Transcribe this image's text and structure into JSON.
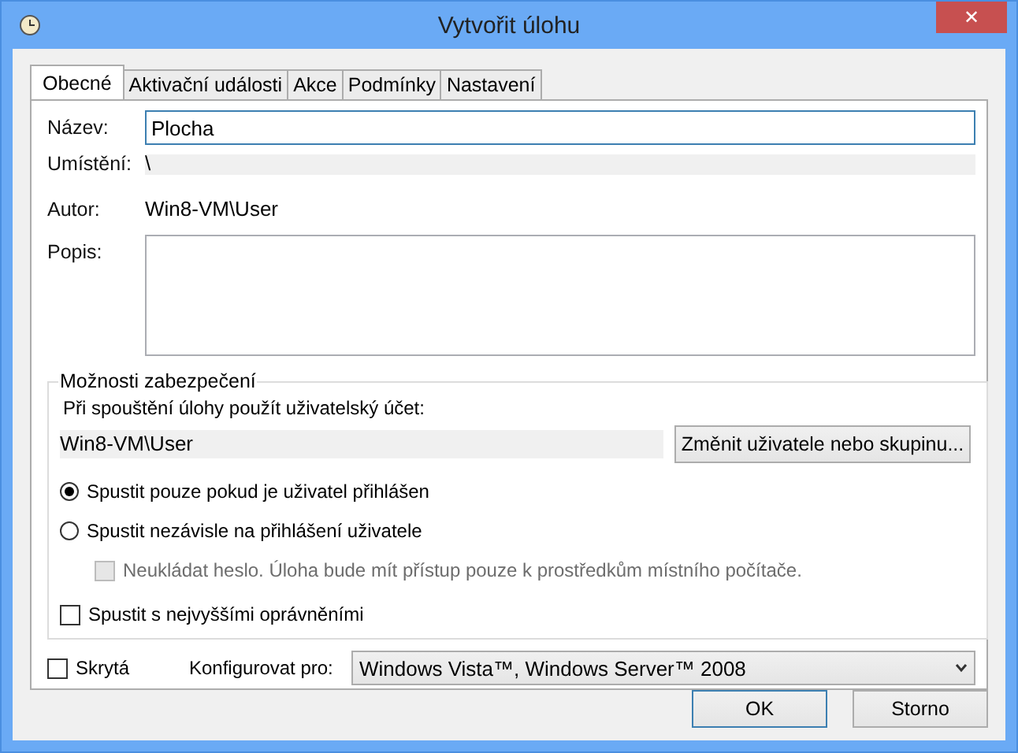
{
  "window": {
    "title": "Vytvořit úlohu",
    "close": "✕"
  },
  "tabs": [
    {
      "label": "Obecné",
      "selected": true
    },
    {
      "label": "Aktivační události",
      "selected": false
    },
    {
      "label": "Akce",
      "selected": false
    },
    {
      "label": "Podmínky",
      "selected": false
    },
    {
      "label": "Nastavení",
      "selected": false
    }
  ],
  "name": {
    "label": "Název:",
    "value": "Plocha"
  },
  "location": {
    "label": "Umístění:",
    "value": "\\"
  },
  "author": {
    "label": "Autor:",
    "value": "Win8-VM\\User"
  },
  "description": {
    "label": "Popis:"
  },
  "security": {
    "title": "Možnosti zabezpečení",
    "account_label": "Při spouštění úlohy použít uživatelský účet:",
    "account": "Win8-VM\\User",
    "change_button": "Změnit uživatele nebo skupinu...",
    "options": [
      {
        "kind": "radio",
        "label": "Spustit pouze pokud je uživatel přihlášen",
        "selected": true,
        "disabled": false,
        "indented": false
      },
      {
        "kind": "radio",
        "label": "Spustit nezávisle na přihlášení uživatele",
        "selected": false,
        "disabled": false,
        "indented": false
      },
      {
        "kind": "checkbox",
        "label": "Neukládat heslo.  Úloha bude mít přístup pouze k prostředkům místního počítače.",
        "checked": false,
        "disabled": true,
        "indented": true
      },
      {
        "kind": "checkbox",
        "label": "Spustit s nejvyššími oprávněními",
        "checked": false,
        "disabled": false,
        "indented": false
      }
    ]
  },
  "hidden": {
    "label": "Skrytá",
    "checked": false
  },
  "configure": {
    "label": "Konfigurovat pro:",
    "value": "Windows Vista™, Windows Server™ 2008"
  },
  "buttons": [
    {
      "label": "OK",
      "default": true
    },
    {
      "label": "Storno",
      "default": false
    }
  ]
}
